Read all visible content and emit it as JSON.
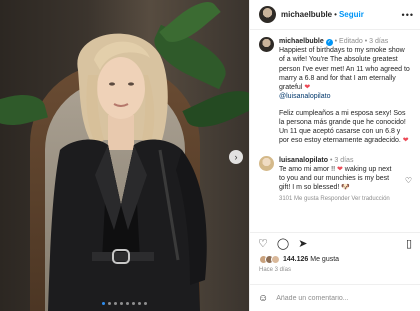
{
  "post": {
    "username": "michaelbuble",
    "follow_label": "Seguir",
    "separator": "•",
    "more_icon": "more-horizontal-icon"
  },
  "caption": {
    "username": "michaelbuble",
    "edited": "Editado",
    "time": "3 días",
    "paragraph1": "Happiest of birthdays to my smoke show of a wife! You're The absolute greatest person I've ever met! An 11 who agreed to marry a 6.8 and for that I am eternally grateful",
    "mention": "@luisanalopilato",
    "paragraph2": "Feliz cumpleaños a mi esposa sexy! Sos la persona más grande que he conocido! Un 11 que aceptó casarse con un 6.8 y por eso estoy eternamente agradecido."
  },
  "comment": {
    "username": "luisanalopilato",
    "time": "3 días",
    "text_part1": "Te amo mi amor !!",
    "text_part2": "waking up next to you and our munchies is my best gift! I m so blessed!",
    "meta": "3101 Me gusta   Responder   Ver traducción"
  },
  "likes": {
    "count": "144.126",
    "label": "Me gusta"
  },
  "date_label": "Hace 3 días",
  "add_comment": {
    "placeholder": "Añade un comentario..."
  },
  "carousel": {
    "slides": 8,
    "active_index": 0
  },
  "colors": {
    "accent": "#0095f6",
    "heart": "#ed4956"
  }
}
